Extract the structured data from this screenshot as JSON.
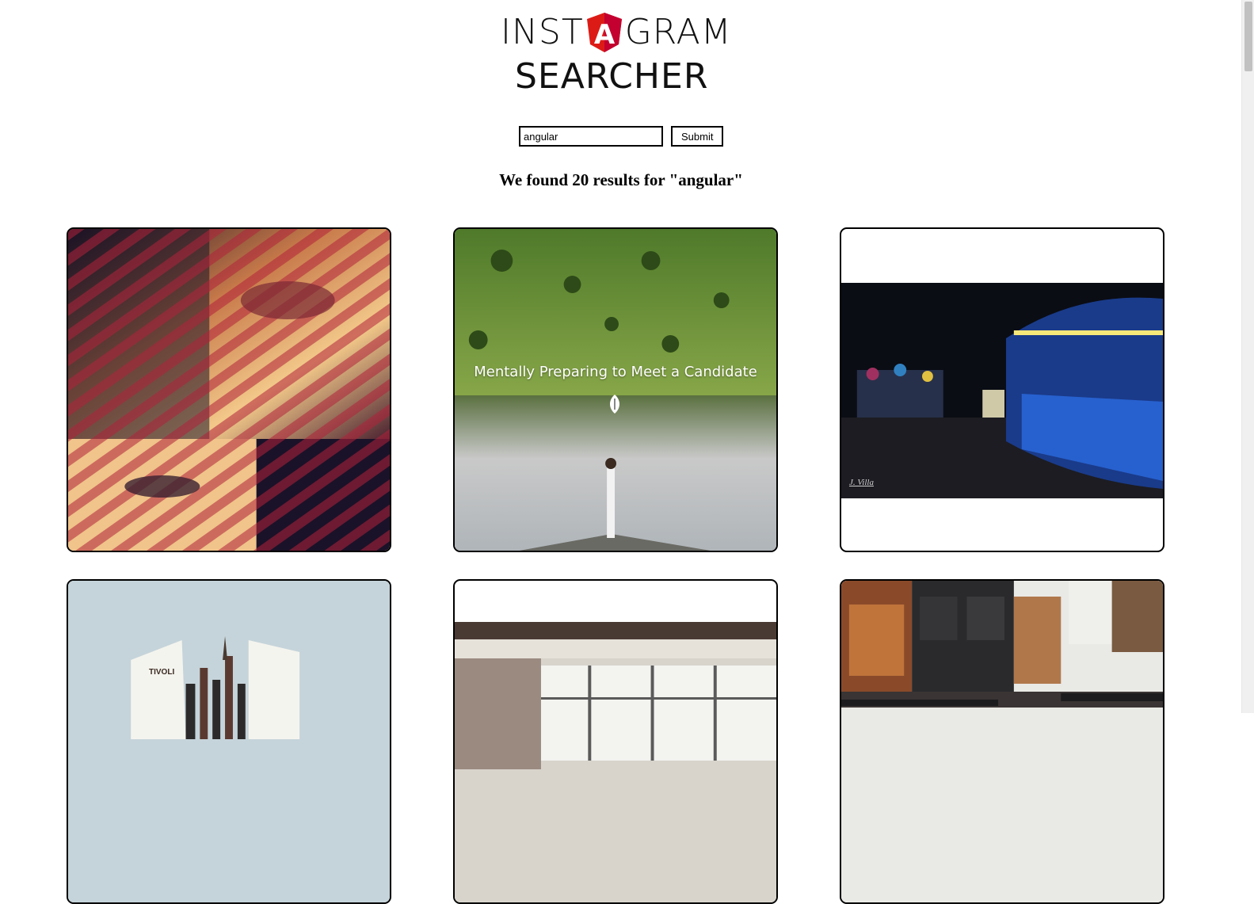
{
  "header": {
    "logo_part1": "INST",
    "logo_shield_letter": "A",
    "logo_part2": "GRAM",
    "logo_line2": "SEARCHER"
  },
  "search": {
    "value": "angular",
    "submit_label": "Submit"
  },
  "results": {
    "heading": "We found 20 results for \"angular\""
  },
  "cards": [
    {
      "image": "portrait-striped-shadows"
    },
    {
      "image": "yoga-lake-landscape",
      "caption": "Mentally Preparing to Meet a Candidate"
    },
    {
      "image": "carousel-night",
      "watermark": "J. Villa"
    },
    {
      "image": "tivoli-building",
      "sign": "TIVOLI"
    },
    {
      "image": "office-window-interior"
    },
    {
      "image": "laptop-slides-wall"
    }
  ],
  "colors": {
    "angular_shield": "#dd1b16",
    "angular_shield_dark": "#c3002f",
    "border": "#000000"
  }
}
